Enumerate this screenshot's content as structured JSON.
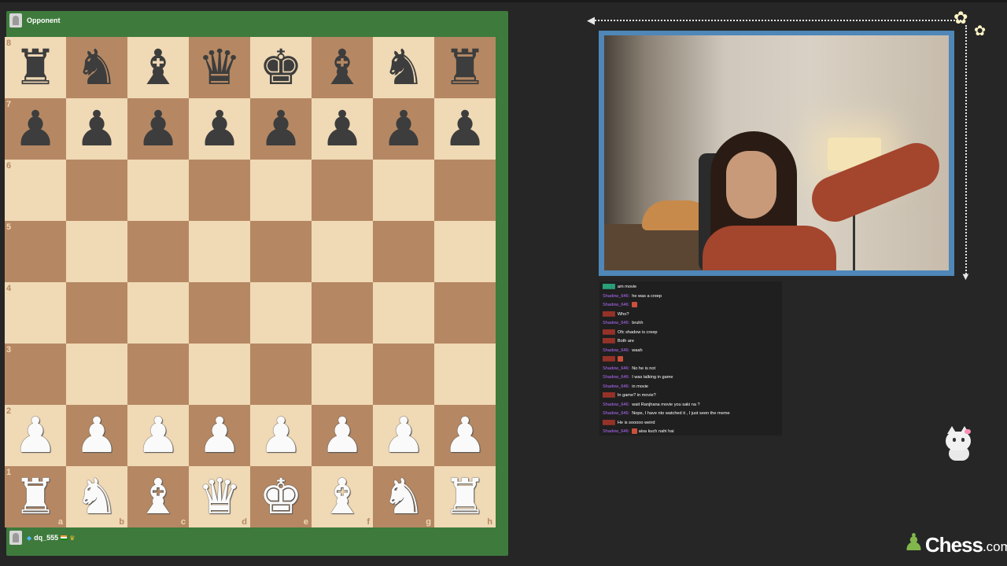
{
  "top_player": {
    "name": "Opponent"
  },
  "bottom_player": {
    "name": "dq_555",
    "badge_icon": "diamond-icon"
  },
  "board": {
    "orientation": "white-bottom",
    "ranks": [
      "8",
      "7",
      "6",
      "5",
      "4",
      "3",
      "2",
      "1"
    ],
    "files": [
      "a",
      "b",
      "c",
      "d",
      "e",
      "f",
      "g",
      "h"
    ],
    "position": [
      [
        "r",
        "n",
        "b",
        "q",
        "k",
        "b",
        "n",
        "r"
      ],
      [
        "p",
        "p",
        "p",
        "p",
        "p",
        "p",
        "p",
        "p"
      ],
      [
        "",
        "",
        "",
        "",
        "",
        "",
        "",
        ""
      ],
      [
        "",
        "",
        "",
        "",
        "",
        "",
        "",
        ""
      ],
      [
        "",
        "",
        "",
        "",
        "",
        "",
        "",
        ""
      ],
      [
        "",
        "",
        "",
        "",
        "",
        "",
        "",
        ""
      ],
      [
        "P",
        "P",
        "P",
        "P",
        "P",
        "P",
        "P",
        "P"
      ],
      [
        "R",
        "N",
        "B",
        "Q",
        "K",
        "B",
        "N",
        "R"
      ]
    ],
    "colors": {
      "light": "#f0d9b5",
      "dark": "#b58863",
      "frame": "#3e7a3c"
    }
  },
  "chat": {
    "messages": [
      {
        "user": "",
        "text": "am movie",
        "color": "#2ecc9a",
        "emote": false
      },
      {
        "user": "Shadow_646:",
        "text": "he was a creep",
        "color": "#b46cff",
        "emote": false
      },
      {
        "user": "Shadow_646:",
        "text": "",
        "color": "#b46cff",
        "emote": true
      },
      {
        "user": "",
        "text": "Who?",
        "color": "#c0392b",
        "emote": false
      },
      {
        "user": "Shadow_646:",
        "text": "bruhh",
        "color": "#b46cff",
        "emote": false
      },
      {
        "user": "",
        "text": "Ofc shadow is creep",
        "color": "#c0392b",
        "emote": false
      },
      {
        "user": "",
        "text": "Both are",
        "color": "#c0392b",
        "emote": false
      },
      {
        "user": "Shadow_646:",
        "text": "waah",
        "color": "#b46cff",
        "emote": false
      },
      {
        "user": "",
        "text": "",
        "color": "#c0392b",
        "emote": true
      },
      {
        "user": "Shadow_646:",
        "text": "No he is not",
        "color": "#b46cff",
        "emote": false
      },
      {
        "user": "Shadow_646:",
        "text": "I was talking in game",
        "color": "#b46cff",
        "emote": false
      },
      {
        "user": "Shadow_646:",
        "text": "in movie",
        "color": "#b46cff",
        "emote": false
      },
      {
        "user": "",
        "text": "In game? in movie?",
        "color": "#c0392b",
        "emote": false
      },
      {
        "user": "Shadow_646:",
        "text": "wait Ranjhana movie you saki na ?",
        "color": "#b46cff",
        "emote": false
      },
      {
        "user": "Shadow_646:",
        "text": "Nope, I have nto watched it , I just seen the meme",
        "color": "#b46cff",
        "emote": false
      },
      {
        "user": "",
        "text": "He is sooooo weird",
        "color": "#c0392b",
        "emote": false
      },
      {
        "user": "Shadow_646:",
        "text": "aisa kuch nahi hai",
        "color": "#b46cff",
        "emote": true
      }
    ]
  },
  "logo": {
    "brand": "Chess",
    "tld": ".com",
    "color": "#81b64c"
  }
}
